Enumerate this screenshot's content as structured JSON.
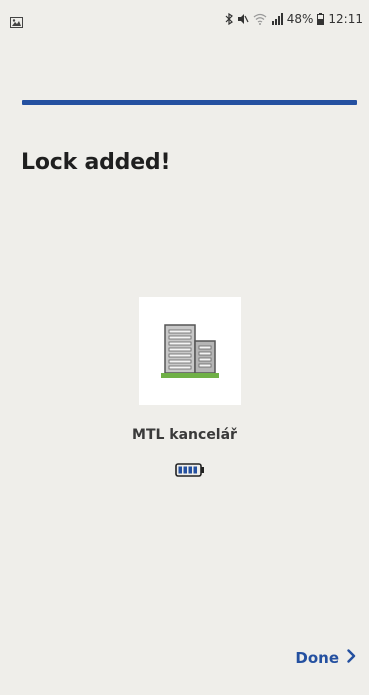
{
  "status_bar": {
    "left_icon": "gallery-notification-icon",
    "icons": [
      "bluetooth-icon",
      "mute-icon",
      "wifi-icon",
      "signal-icon"
    ],
    "battery_percent": "48%",
    "time": "12:11"
  },
  "header": {
    "title": "Lock added!"
  },
  "lock": {
    "icon": "building-icon",
    "name": "MTL kancelář",
    "battery_icon": "battery-full-icon",
    "battery_level": 1.0
  },
  "footer": {
    "done_label": "Done",
    "done_icon": "chevron-right-icon"
  },
  "colors": {
    "background": "#efeeea",
    "accent": "#2450a0",
    "tile": "#ffffff",
    "text": "#1f1f1f"
  }
}
